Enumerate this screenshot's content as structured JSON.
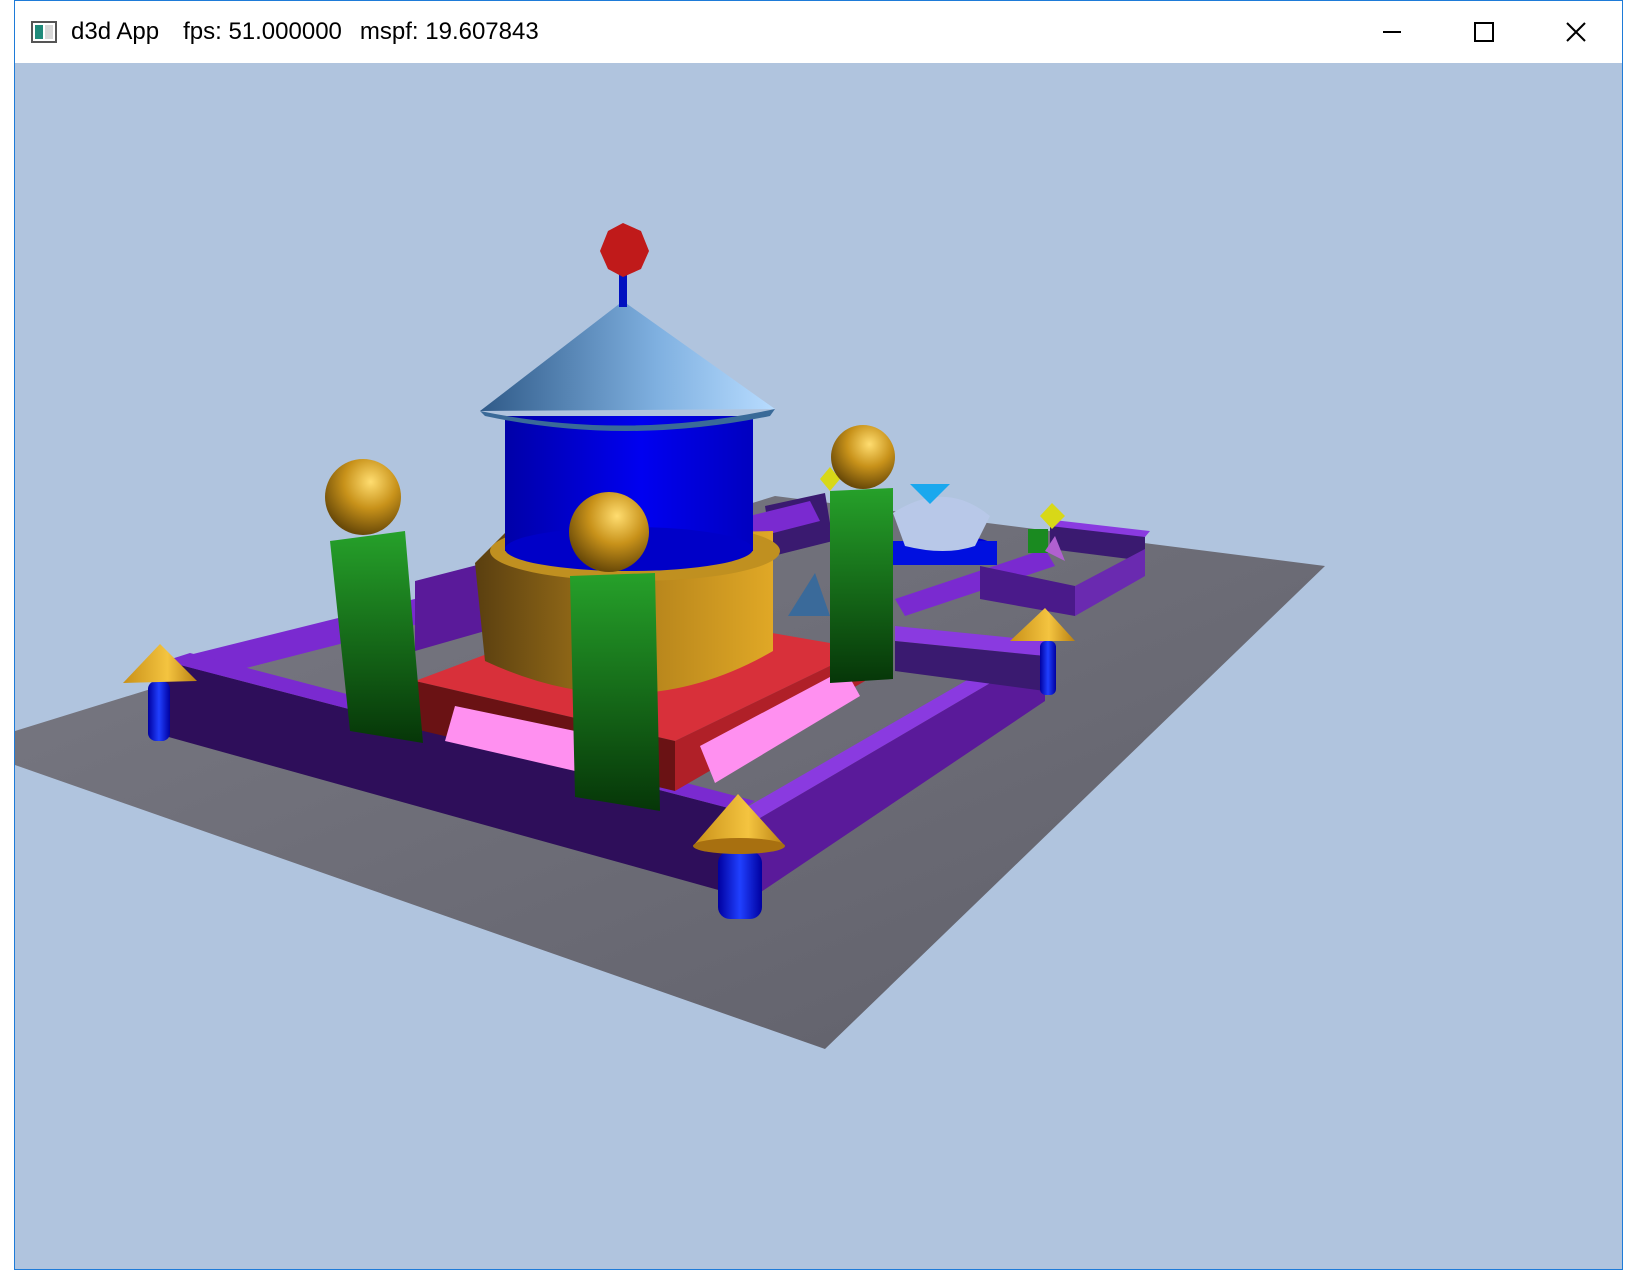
{
  "window": {
    "title": "d3d App",
    "fps_label": "fps: 51.000000",
    "mspf_label": "mspf: 19.607843",
    "controls": {
      "minimize_icon": "minimize-icon",
      "maximize_icon": "maximize-icon",
      "close_icon": "close-icon"
    }
  },
  "scene": {
    "background_color": "#b0c4de",
    "ground_color": "#6f6f79",
    "wall_color": "#5a1a9a",
    "objects": [
      "ground-plane",
      "castle-walls",
      "corner-towers",
      "central-tower",
      "pillars",
      "fountain"
    ]
  }
}
